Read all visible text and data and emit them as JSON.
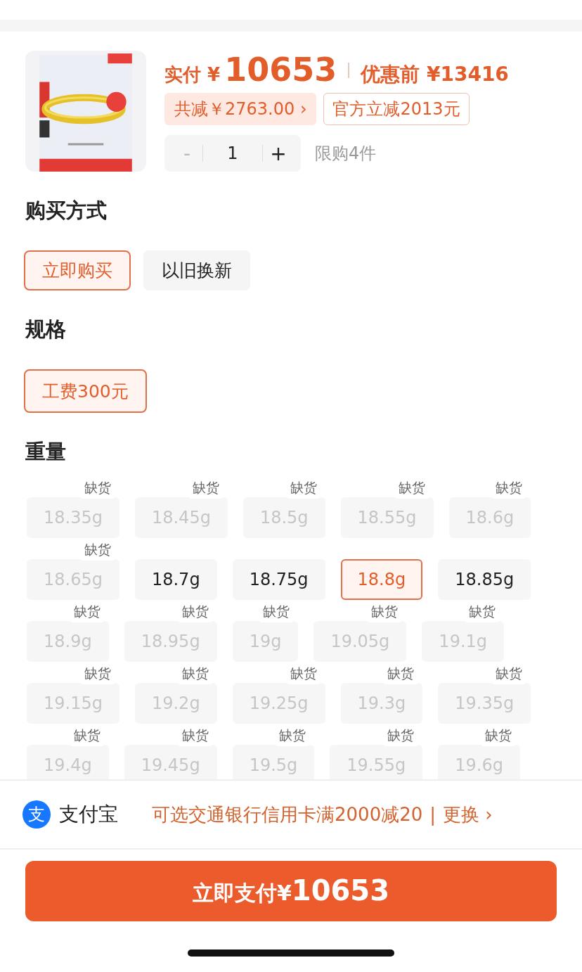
{
  "product": {
    "paid_label": "实付",
    "paid_currency": "¥",
    "paid_amount": "10653",
    "original_label": "优惠前",
    "original_price": "¥13416",
    "discount_total": "共减￥2763.00",
    "discount_arrow": "›",
    "official_discount": "官方立减2013元",
    "quantity": {
      "minus": "-",
      "value": "1",
      "plus": "+",
      "minus_disabled": true
    },
    "limit": "限购4件"
  },
  "purchase_method": {
    "title": "购买方式",
    "options": [
      {
        "label": "立即购买",
        "selected": true
      },
      {
        "label": "以旧换新",
        "selected": false
      }
    ]
  },
  "spec": {
    "title": "规格",
    "options": [
      {
        "label": "工费300元",
        "selected": true
      }
    ]
  },
  "weight": {
    "title": "重量",
    "options": [
      {
        "label": "18.35g",
        "kind": "out_of_stock",
        "badge": "缺货",
        "selected": false
      },
      {
        "label": "18.45g",
        "kind": "out_of_stock",
        "badge": "缺货",
        "selected": false
      },
      {
        "label": "18.5g",
        "kind": "out_of_stock",
        "badge": "缺货",
        "selected": false
      },
      {
        "label": "18.55g",
        "kind": "out_of_stock",
        "badge": "缺货",
        "selected": false
      },
      {
        "label": "18.6g",
        "kind": "out_of_stock",
        "badge": "缺货",
        "selected": false
      },
      {
        "label": "18.65g",
        "kind": "out_of_stock",
        "badge": "缺货",
        "selected": false
      },
      {
        "label": "18.7g",
        "kind": "available",
        "selected": false
      },
      {
        "label": "18.75g",
        "kind": "available",
        "selected": false
      },
      {
        "label": "18.8g",
        "kind": "available",
        "selected": true
      },
      {
        "label": "18.85g",
        "kind": "available",
        "selected": false
      },
      {
        "label": "18.9g",
        "kind": "out_of_stock",
        "badge": "缺货",
        "selected": false
      },
      {
        "label": "18.95g",
        "kind": "out_of_stock",
        "badge": "缺货",
        "selected": false
      },
      {
        "label": "19g",
        "kind": "out_of_stock",
        "badge": "缺货",
        "selected": false
      },
      {
        "label": "19.05g",
        "kind": "out_of_stock",
        "badge": "缺货",
        "selected": false
      },
      {
        "label": "19.1g",
        "kind": "out_of_stock",
        "badge": "缺货",
        "selected": false
      },
      {
        "label": "19.15g",
        "kind": "out_of_stock",
        "badge": "缺货",
        "selected": false
      },
      {
        "label": "19.2g",
        "kind": "out_of_stock",
        "badge": "缺货",
        "selected": false
      },
      {
        "label": "19.25g",
        "kind": "out_of_stock",
        "badge": "缺货",
        "selected": false
      },
      {
        "label": "19.3g",
        "kind": "out_of_stock",
        "badge": "缺货",
        "selected": false
      },
      {
        "label": "19.35g",
        "kind": "out_of_stock",
        "badge": "缺货",
        "selected": false
      },
      {
        "label": "19.4g",
        "kind": "out_of_stock",
        "badge": "缺货",
        "selected": false
      },
      {
        "label": "19.45g",
        "kind": "out_of_stock",
        "badge": "缺货",
        "selected": false
      },
      {
        "label": "19.5g",
        "kind": "out_of_stock",
        "badge": "缺货",
        "selected": false
      },
      {
        "label": "19.55g",
        "kind": "out_of_stock",
        "badge": "缺货",
        "selected": false
      },
      {
        "label": "19.6g",
        "kind": "out_of_stock",
        "badge": "缺货",
        "selected": false
      }
    ]
  },
  "payment": {
    "icon_glyph": "支",
    "method": "支付宝",
    "offer": "可选交通银行信用卡满2000减20",
    "divider": "|",
    "change": "更换",
    "arrow": "›"
  },
  "pay_button": {
    "label": "立即支付",
    "currency": "¥",
    "amount": "10653"
  }
}
